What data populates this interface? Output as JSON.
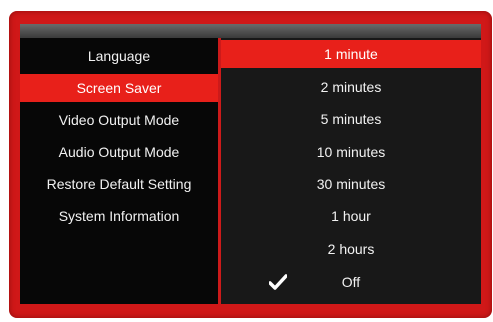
{
  "settings_menu": {
    "items": [
      {
        "label": "Language"
      },
      {
        "label": "Screen Saver"
      },
      {
        "label": "Video Output Mode"
      },
      {
        "label": "Audio Output Mode"
      },
      {
        "label": "Restore Default Setting"
      },
      {
        "label": "System Information"
      }
    ],
    "selected": "Screen Saver"
  },
  "screen_saver_options": {
    "items": [
      {
        "label": "1 minute"
      },
      {
        "label": "2 minutes"
      },
      {
        "label": "5 minutes"
      },
      {
        "label": "10 minutes"
      },
      {
        "label": "30 minutes"
      },
      {
        "label": "1 hour"
      },
      {
        "label": "2 hours"
      },
      {
        "label": "Off"
      }
    ],
    "highlighted": "1 minute",
    "checked": "Off"
  },
  "colors": {
    "bezel": "#d01818",
    "highlight": "#e8201a",
    "left_panel_bg": "#070707",
    "right_panel_bg": "#181818",
    "text": "#f2f2f2"
  },
  "icons": {
    "checked_marker": "checkmark-icon"
  }
}
